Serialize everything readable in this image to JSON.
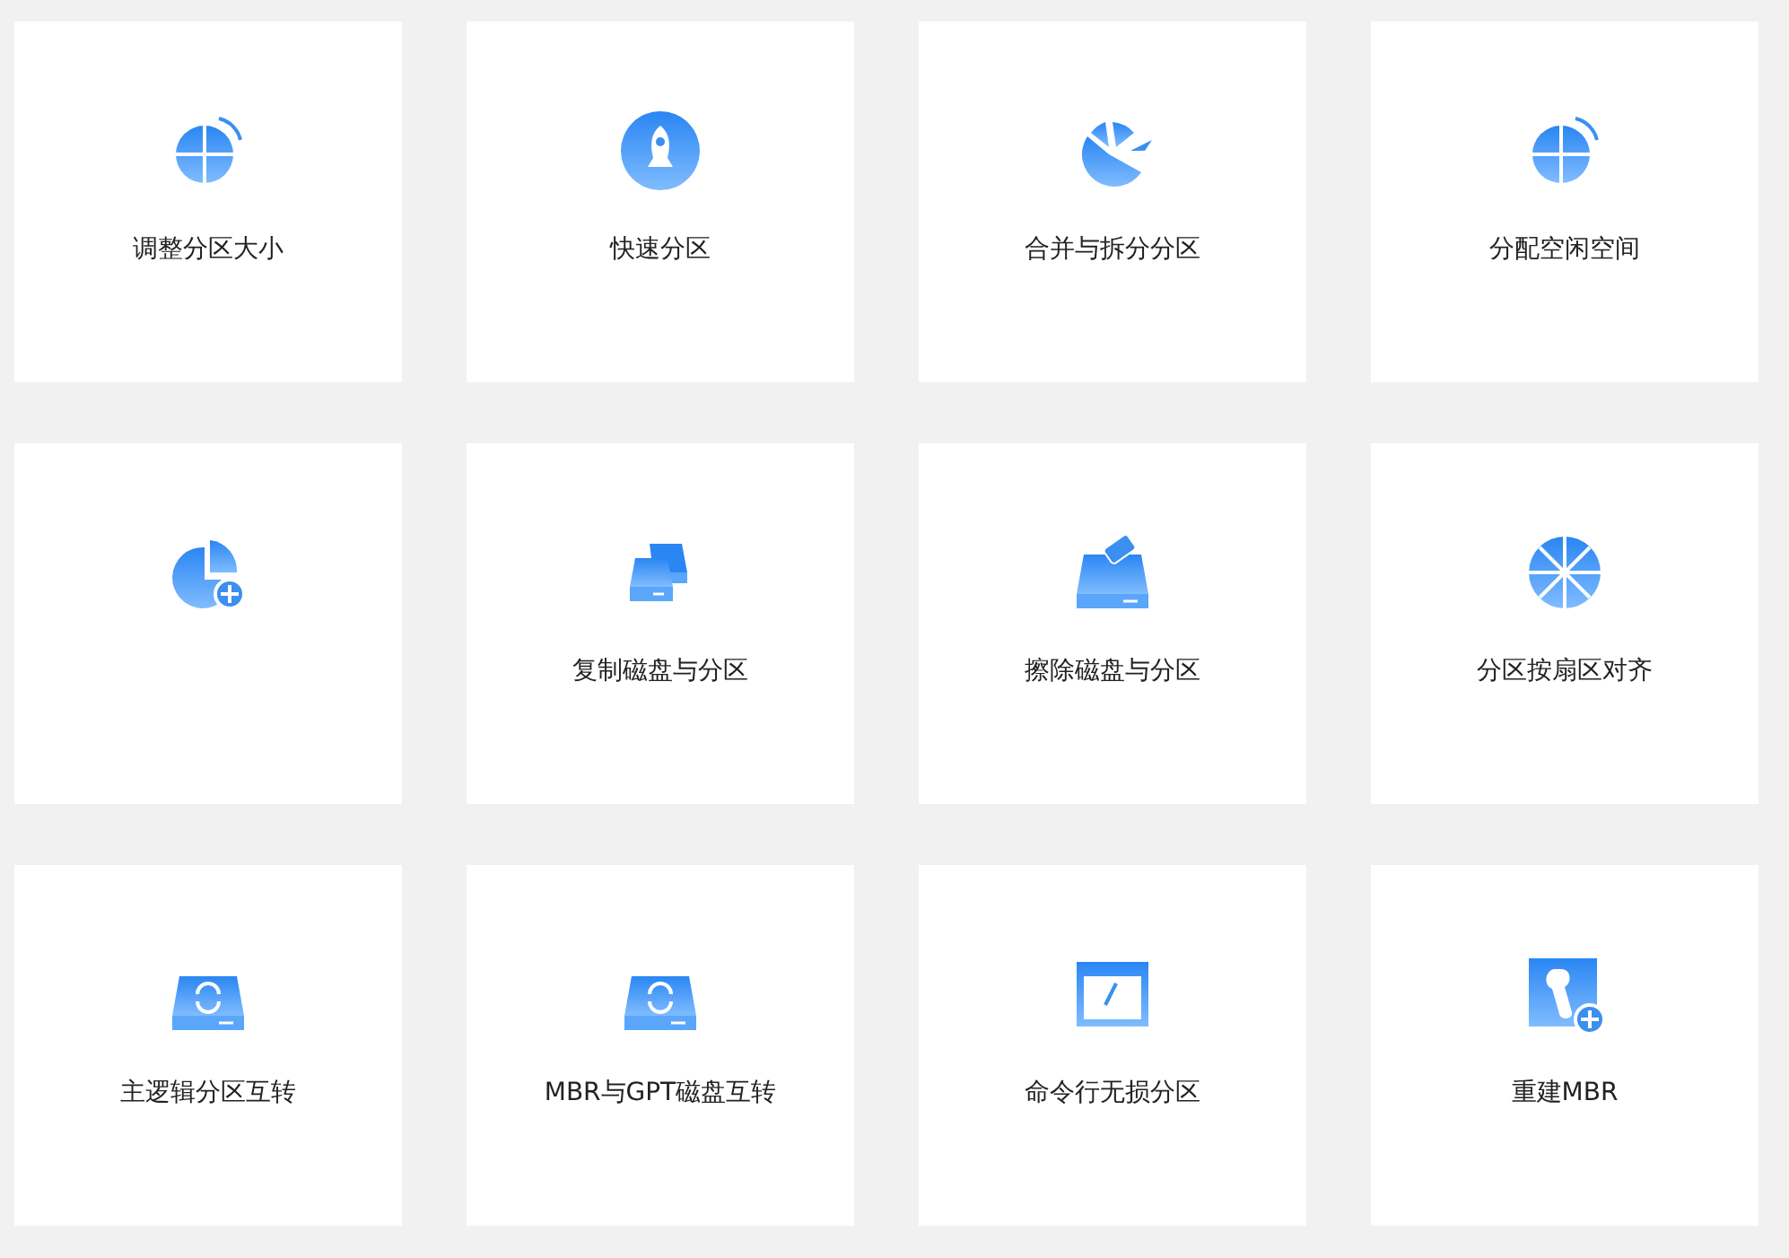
{
  "features": [
    {
      "kind": "resize",
      "label": "调整分区大小"
    },
    {
      "kind": "quick",
      "label": "快速分区"
    },
    {
      "kind": "merge",
      "label": "合并与拆分分区"
    },
    {
      "kind": "allocate",
      "label": "分配空闲空间"
    },
    {
      "kind": "create"
    },
    {
      "kind": "copy",
      "label": "复制磁盘与分区"
    },
    {
      "kind": "wipe",
      "label": "擦除磁盘与分区"
    },
    {
      "kind": "align",
      "label": "分区按扇区对齐"
    },
    {
      "kind": "convert",
      "label": "主逻辑分区互转"
    },
    {
      "kind": "disk",
      "label": "MBR与GPT磁盘互转"
    },
    {
      "kind": "cmd",
      "label": "命令行无损分区"
    },
    {
      "kind": "mbr",
      "label": "重建MBR"
    }
  ]
}
